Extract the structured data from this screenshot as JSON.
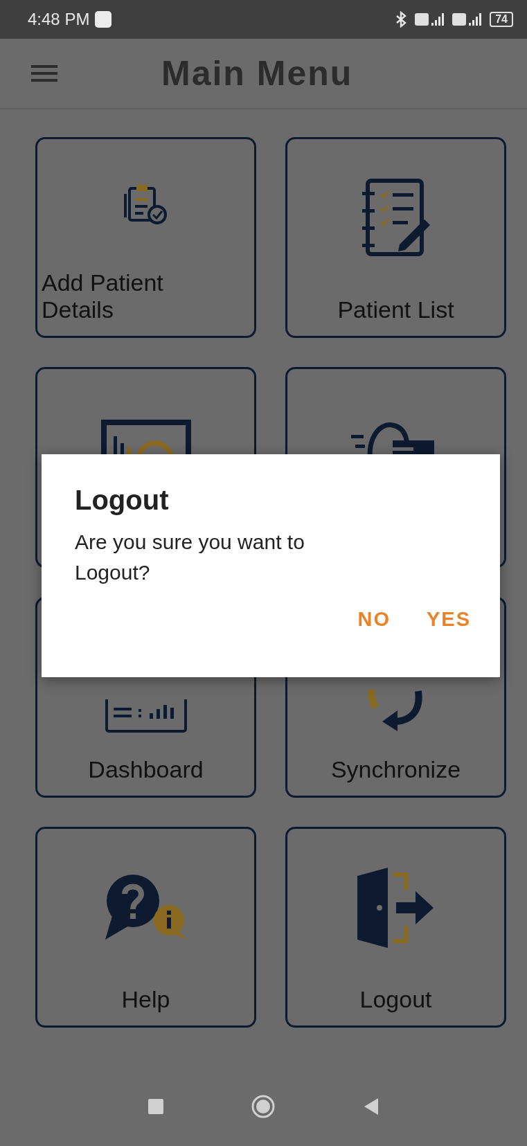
{
  "status_bar": {
    "time": "4:48 PM",
    "battery": "74"
  },
  "header": {
    "title": "Main Menu"
  },
  "tiles": [
    {
      "kind": "add_patient",
      "label": "Add Patient Details"
    },
    {
      "kind": "patient_list",
      "label": "Patient List"
    },
    {
      "kind": "reports"
    },
    {
      "kind": "search"
    },
    {
      "kind": "dashboard",
      "label": "Dashboard"
    },
    {
      "kind": "sync",
      "label": "Synchronize"
    },
    {
      "kind": "help",
      "label": "Help"
    },
    {
      "kind": "logout",
      "label": "Logout"
    }
  ],
  "dialog": {
    "title": "Logout",
    "message": "Are you sure you want to Logout?",
    "buttons": [
      "NO",
      "YES"
    ]
  }
}
